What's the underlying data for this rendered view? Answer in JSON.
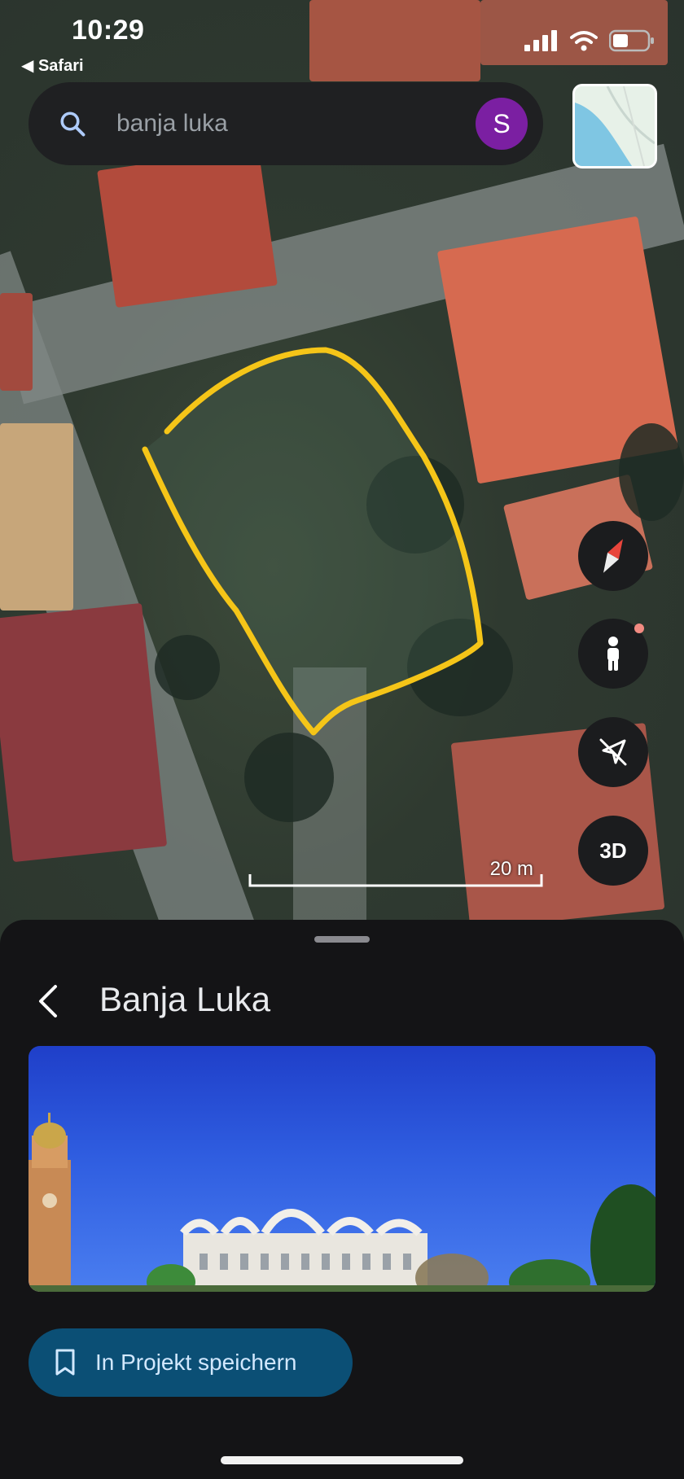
{
  "status_bar": {
    "time": "10:29",
    "back_app": "Safari",
    "icons": [
      "cellular-signal-icon",
      "wifi-icon",
      "battery-icon"
    ]
  },
  "search": {
    "query": "banja luka",
    "avatar_letter": "S"
  },
  "map_controls": {
    "compass": "compass-icon",
    "street_view": "pegman-icon",
    "location": "location-off-icon",
    "threed_label": "3D"
  },
  "scale": {
    "label": "20 m"
  },
  "sheet": {
    "title": "Banja Luka",
    "save_label": "In Projekt speichern"
  },
  "colors": {
    "accent_yellow": "#f5c518",
    "avatar_purple": "#7b1fa2",
    "save_button_bg": "#0b4f75",
    "sheet_bg": "#141416"
  }
}
